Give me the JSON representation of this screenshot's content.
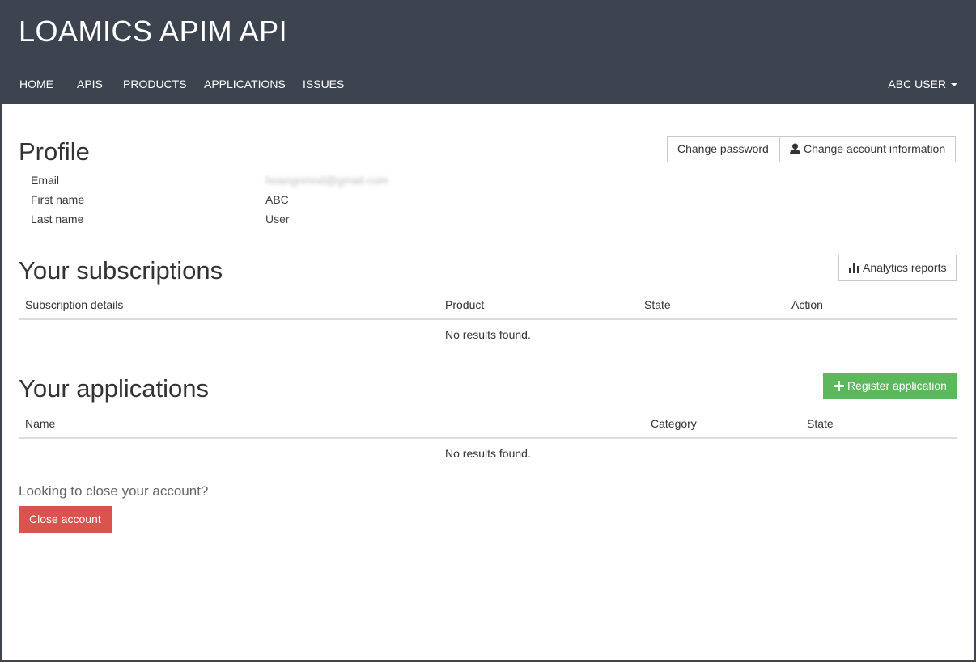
{
  "header": {
    "brand": "LOAMICS APIM API",
    "nav": [
      {
        "label": "HOME"
      },
      {
        "label": "APIS"
      },
      {
        "label": "PRODUCTS"
      },
      {
        "label": "APPLICATIONS"
      },
      {
        "label": "ISSUES"
      }
    ],
    "user_menu_label": "ABC USER"
  },
  "profile": {
    "title": "Profile",
    "change_password_label": "Change password",
    "change_account_label": "Change account information",
    "fields": [
      {
        "label": "Email",
        "value": "hoangnmnd@gmail.com"
      },
      {
        "label": "First name",
        "value": "ABC"
      },
      {
        "label": "Last name",
        "value": "User"
      }
    ]
  },
  "subscriptions": {
    "title": "Your subscriptions",
    "analytics_label": "Analytics reports",
    "columns": [
      "Subscription details",
      "Product",
      "State",
      "Action"
    ],
    "empty_text": "No results found."
  },
  "applications": {
    "title": "Your applications",
    "register_label": "Register application",
    "columns": [
      "Name",
      "Category",
      "State"
    ],
    "empty_text": "No results found."
  },
  "close_account": {
    "prompt": "Looking to close your account?",
    "button_label": "Close account"
  },
  "colors": {
    "header_bg": "#3d4450",
    "success": "#5cb85c",
    "danger": "#d9534f"
  },
  "icons": {
    "user": "user-icon",
    "chart": "bar-chart-icon",
    "plus": "plus-icon",
    "caret": "caret-down-icon"
  }
}
